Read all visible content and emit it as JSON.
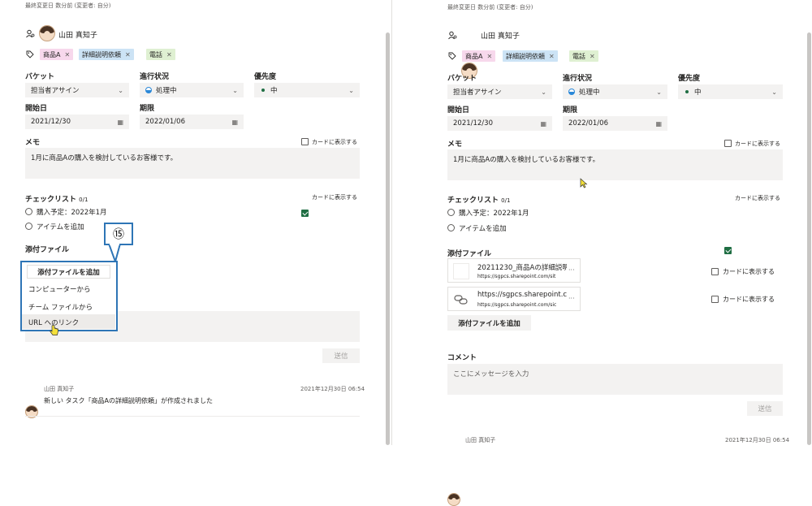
{
  "left": {
    "modified": "最終変更日 数分前 (変更者: 自分)",
    "assignee": "山田 真知子",
    "labels": [
      {
        "text": "商品A",
        "bg": "#f7d8ec"
      },
      {
        "text": "詳細説明依頼",
        "bg": "#cce3f5"
      },
      {
        "text": "電話",
        "bg": "#dff0d2"
      }
    ],
    "bucket_label": "バケット",
    "bucket_value": "担当者アサイン",
    "progress_label": "進行状況",
    "progress_value": "処理中",
    "priority_label": "優先度",
    "priority_value": "中",
    "start_label": "開始日",
    "start_value": "2021/12/30",
    "due_label": "期限",
    "due_value": "2022/01/06",
    "notes_label": "メモ",
    "show_on_card": "カードに表示する",
    "notes_text": "1月に商品Aの購入を検討しているお客様です。",
    "checklist_label": "チェックリスト",
    "checklist_count": "0/1",
    "checklist_items": [
      "購入予定：2022年1月",
      "アイテムを追加"
    ],
    "attach_label": "添付ファイル",
    "callout_number": "⑮",
    "menu_header": "添付ファイルを追加",
    "menu_items": [
      "コンピューターから",
      "チーム ファイルから",
      "URL へのリンク"
    ],
    "send": "送信",
    "activity_name": "山田 真知子",
    "activity_time": "2021年12月30日 06:54",
    "activity_text": "新しい タスク「商品Aの詳細説明依頼」が作成されました"
  },
  "right": {
    "modified": "最終変更日 数分前 (変更者: 自分)",
    "assignee": "山田 真知子",
    "labels": [
      {
        "text": "商品A",
        "bg": "#f7d8ec"
      },
      {
        "text": "詳細説明依頼",
        "bg": "#cce3f5"
      },
      {
        "text": "電話",
        "bg": "#dff0d2"
      }
    ],
    "bucket_label": "バケット",
    "bucket_value": "担当者アサイン",
    "progress_label": "進行状況",
    "progress_value": "処理中",
    "priority_label": "優先度",
    "priority_value": "中",
    "start_label": "開始日",
    "start_value": "2021/12/30",
    "due_label": "期限",
    "due_value": "2022/01/06",
    "notes_label": "メモ",
    "show_on_card": "カードに表示する",
    "notes_text": "1月に商品Aの購入を検討しているお客様です。",
    "checklist_label": "チェックリスト",
    "checklist_count": "0/1",
    "checklist_items": [
      "購入予定：2022年1月",
      "アイテムを追加"
    ],
    "attach_label": "添付ファイル",
    "attachments": [
      {
        "title": "20211230_商品Aの詳細説明",
        "url": "https://sgpcs.sharepoint.com/sit",
        "more": "···"
      },
      {
        "title": "https://sgpcs.sharepoint.co",
        "url": "https://sgpcs.sharepoint.com/sic",
        "more": "···"
      }
    ],
    "add_attachment": "添付ファイルを追加",
    "comment_label": "コメント",
    "comment_placeholder": "ここにメッセージを入力",
    "send": "送信",
    "activity_name": "山田 真知子",
    "activity_time": "2021年12月30日 06:54"
  },
  "colors": {
    "accent": "#2e75b6",
    "check": "#1f6e43",
    "progress": "#2b88d8",
    "priority": "#1f6e43"
  }
}
